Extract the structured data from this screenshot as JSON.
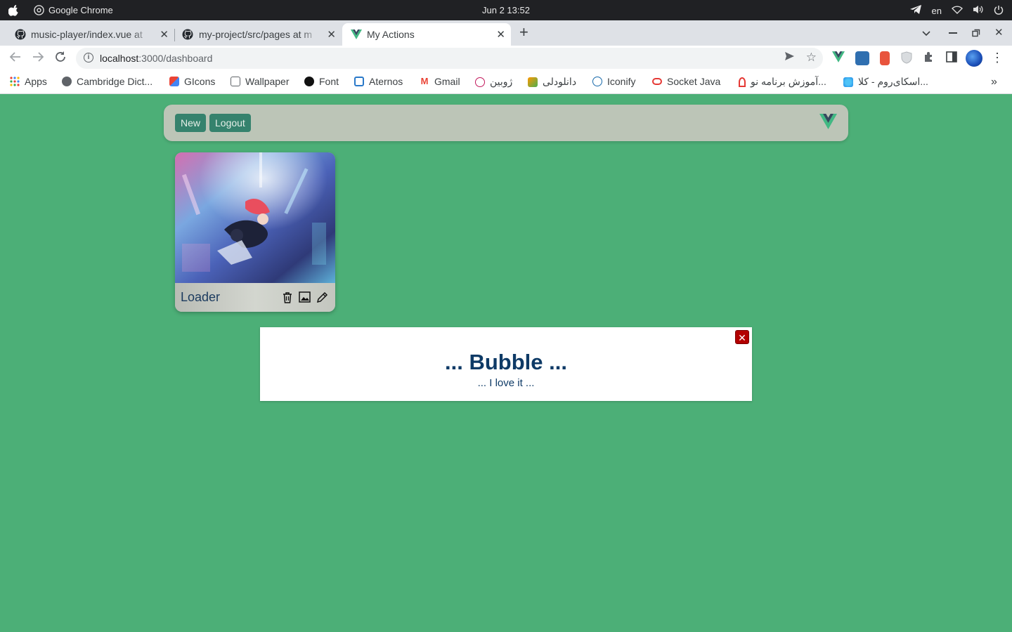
{
  "os": {
    "app_name": "Google Chrome",
    "clock": "Jun 2  13:52",
    "lang": "en"
  },
  "tabs": [
    {
      "title": "music-player/index.vue at"
    },
    {
      "title": "my-project/src/pages at m"
    },
    {
      "title": "My Actions"
    }
  ],
  "address": {
    "host": "localhost",
    "path": ":3000/dashboard"
  },
  "bookmarks": [
    {
      "label": "Apps"
    },
    {
      "label": "Cambridge Dict..."
    },
    {
      "label": "GIcons"
    },
    {
      "label": "Wallpaper"
    },
    {
      "label": "Font"
    },
    {
      "label": "Aternos"
    },
    {
      "label": "Gmail"
    },
    {
      "label": "ژوبین"
    },
    {
      "label": "دانلودلی"
    },
    {
      "label": "Iconify"
    },
    {
      "label": "Socket Java"
    },
    {
      "label": "آموزش برنامه نو..."
    },
    {
      "label": "اسکای‌روم - کلا..."
    }
  ],
  "navbar": {
    "new_label": "New",
    "logout_label": "Logout"
  },
  "card": {
    "name": "Loader"
  },
  "modal": {
    "title": "... Bubble ...",
    "subtitle": "... I love it ...",
    "close": "✕"
  },
  "colors": {
    "page_bg": "#4caf77",
    "navbar_bg": "#bcc5b7",
    "button_bg": "#35826d",
    "modal_text": "#0e3a66",
    "close_bg": "#b30000"
  }
}
